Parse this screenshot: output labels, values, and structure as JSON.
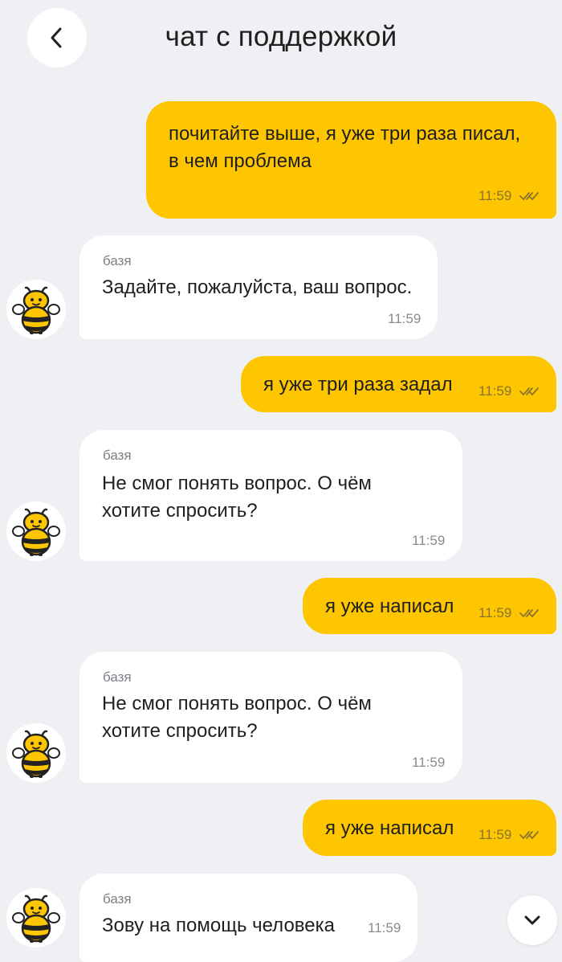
{
  "header": {
    "title": "чат с поддержкой"
  },
  "colors": {
    "background": "#eef0f3",
    "outgoing_bubble": "#fdc600",
    "incoming_bubble": "#ffffff",
    "text": "#1f1f1f",
    "meta": "#8a8a8a"
  },
  "icons": {
    "back": "chevron-left-icon",
    "read_status": "double-check-icon",
    "scroll_down": "chevron-down-icon",
    "avatar": "bee-mascot"
  },
  "messages": [
    {
      "from": "me",
      "text_lines": [
        "почитайте выше, я уже три раза писал,",
        "в чем проблема"
      ],
      "time": "11:59"
    },
    {
      "from": "bot",
      "sender": "базя",
      "text_lines": [
        "Задайте, пожалуйста, ваш вопрос."
      ],
      "time": "11:59"
    },
    {
      "from": "me",
      "text_lines": [
        "я уже три раза задал"
      ],
      "time": "11:59"
    },
    {
      "from": "bot",
      "sender": "базя",
      "text_lines": [
        "Не смог понять вопрос. О чём",
        "хотите спросить?"
      ],
      "time": "11:59"
    },
    {
      "from": "me",
      "text_lines": [
        "я уже написал"
      ],
      "time": "11:59"
    },
    {
      "from": "bot",
      "sender": "базя",
      "text_lines": [
        "Не смог понять вопрос. О чём",
        "хотите спросить?"
      ],
      "time": "11:59"
    },
    {
      "from": "me",
      "text_lines": [
        "я уже написал"
      ],
      "time": "11:59"
    },
    {
      "from": "bot",
      "sender": "базя",
      "text_lines": [
        "Зову на помощь человека"
      ],
      "time": "11:59"
    }
  ]
}
